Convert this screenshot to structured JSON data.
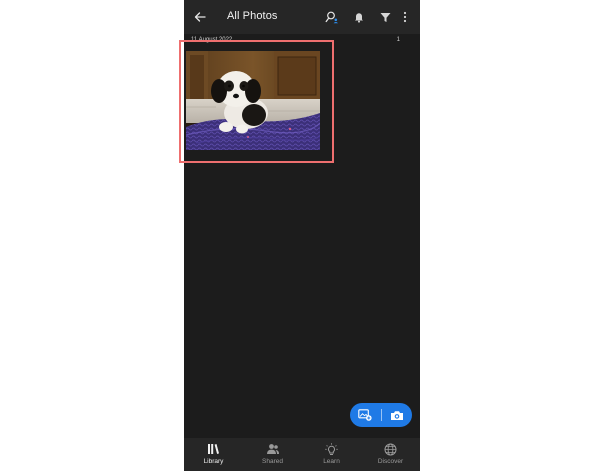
{
  "header": {
    "title": "All Photos",
    "back_icon": "arrow-left-icon",
    "icons": [
      "people-search-icon",
      "bell-icon",
      "filter-icon",
      "more-vertical-icon"
    ]
  },
  "group": {
    "date": "11 August 2022",
    "count": "1"
  },
  "fab": {
    "left_icon": "add-photo-icon",
    "right_icon": "camera-icon",
    "color": "#1f7ae6"
  },
  "nav": {
    "items": [
      {
        "label": "Library",
        "icon": "library-icon",
        "active": true
      },
      {
        "label": "Shared",
        "icon": "shared-people-icon",
        "active": false
      },
      {
        "label": "Learn",
        "icon": "lightbulb-icon",
        "active": false
      },
      {
        "label": "Discover",
        "icon": "globe-icon",
        "active": false
      }
    ]
  },
  "colors": {
    "background": "#1c1c1c",
    "bar": "#262626",
    "accent": "#1f7ae6",
    "highlight": "#ee6f6f"
  }
}
